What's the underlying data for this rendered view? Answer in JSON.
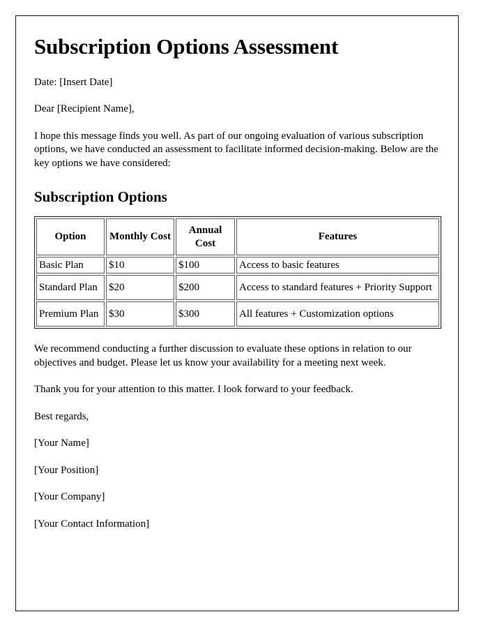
{
  "document": {
    "title": "Subscription Options Assessment",
    "date_line": "Date: [Insert Date]",
    "salutation": "Dear [Recipient Name],",
    "intro_paragraph": "I hope this message finds you well. As part of our ongoing evaluation of various subscription options, we have conducted an assessment to facilitate informed decision-making. Below are the key options we have considered:",
    "section_heading": "Subscription Options",
    "recommendation_paragraph": "We recommend conducting a further discussion to evaluate these options in relation to our objectives and budget. Please let us know your availability for a meeting next week.",
    "thanks_paragraph": "Thank you for your attention to this matter. I look forward to your feedback.",
    "closing": "Best regards,",
    "signature": {
      "name": "[Your Name]",
      "position": "[Your Position]",
      "company": "[Your Company]",
      "contact": "[Your Contact Information]"
    }
  },
  "table": {
    "headers": {
      "option": "Option",
      "monthly_cost": "Monthly Cost",
      "annual_cost": "Annual Cost",
      "features": "Features"
    },
    "rows": [
      {
        "option": "Basic Plan",
        "monthly_cost": "$10",
        "annual_cost": "$100",
        "features": "Access to basic features"
      },
      {
        "option": "Standard Plan",
        "monthly_cost": "$20",
        "annual_cost": "$200",
        "features": "Access to standard features + Priority Support"
      },
      {
        "option": "Premium Plan",
        "monthly_cost": "$30",
        "annual_cost": "$300",
        "features": "All features + Customization options"
      }
    ]
  },
  "colors": {
    "text": "#000000",
    "page_border": "#1a1a1a",
    "cell_border": "#5a5a5a",
    "background": "#ffffff"
  }
}
